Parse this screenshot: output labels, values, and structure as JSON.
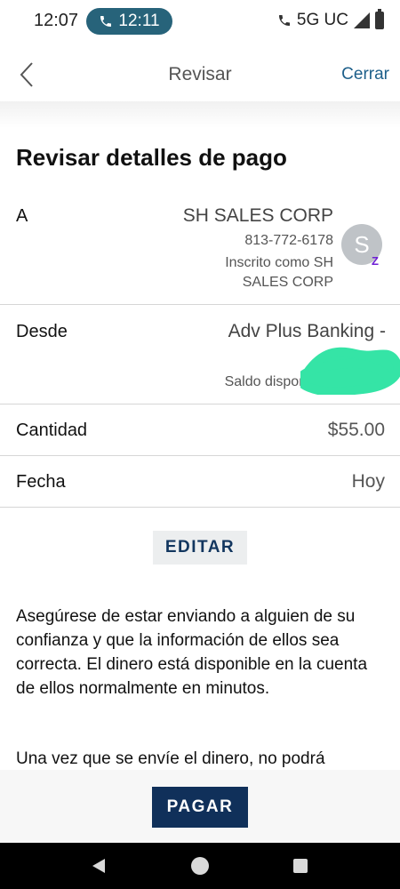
{
  "status_bar": {
    "time": "12:07",
    "call_time": "12:11",
    "network": "5G UC"
  },
  "header": {
    "title": "Revisar",
    "close_label": "Cerrar"
  },
  "page_title": "Revisar detalles de pago",
  "to": {
    "label": "A",
    "name": "SH SALES CORP",
    "phone": "813-772-6178",
    "enrolled_line1": "Inscrito como SH",
    "enrolled_line2": "SALES CORP",
    "avatar_initial": "S",
    "badge": "Z"
  },
  "from": {
    "label": "Desde",
    "account": "Adv Plus Banking -",
    "balance_label": "Saldo disponible"
  },
  "amount": {
    "label": "Cantidad",
    "value": "$55.00"
  },
  "date": {
    "label": "Fecha",
    "value": "Hoy"
  },
  "edit_label": "EDITAR",
  "notice": {
    "paragraph1": "Asegúrese de estar enviando a alguien de su confianza y que la información de ellos sea correcta. El dinero está disponible en la cuenta de ellos normalmente en minutos.",
    "paragraph2": "Una vez que se envíe el dinero, no podrá"
  },
  "pay_label": "PAGAR",
  "colors": {
    "accent": "#1d5f8a",
    "primary_button": "#10305a",
    "call_pill": "#27637a",
    "redaction": "#35e4a6"
  }
}
